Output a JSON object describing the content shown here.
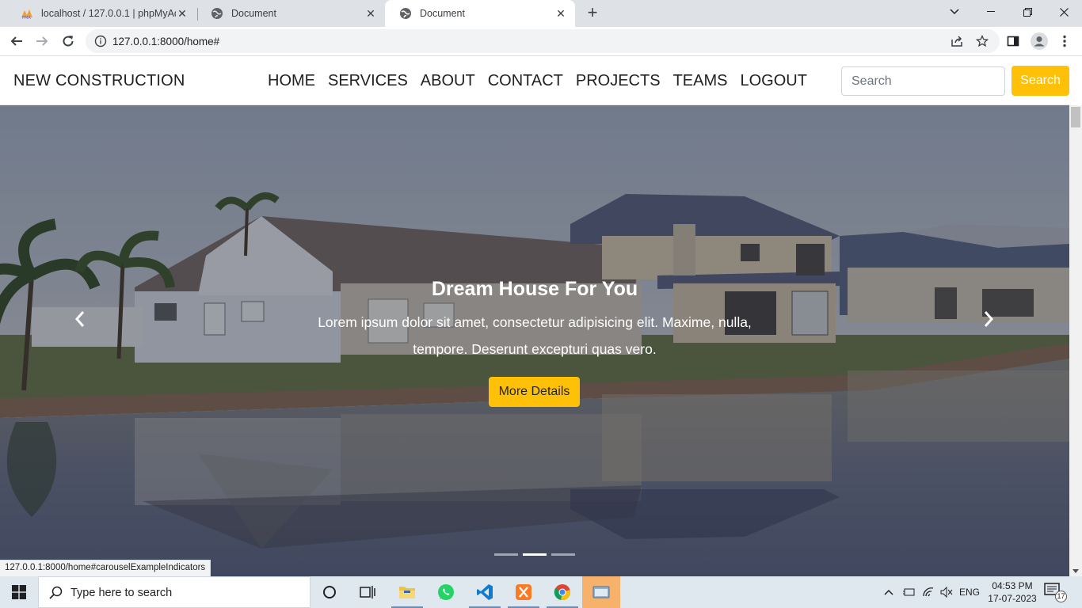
{
  "browser": {
    "tabs": [
      {
        "title": "localhost / 127.0.0.1 | phpMyAdm",
        "icon": "phpmyadmin-icon",
        "active": false
      },
      {
        "title": "Document",
        "icon": "globe-icon",
        "active": false
      },
      {
        "title": "Document",
        "icon": "globe-icon",
        "active": true
      }
    ],
    "url": "127.0.0.1:8000/home#",
    "status_url": "127.0.0.1:8000/home#carouselExampleIndicators"
  },
  "site": {
    "brand": "NEW CONSTRUCTION",
    "menu": [
      "HOME",
      "SERVICES",
      "ABOUT",
      "CONTACT",
      "PROJECTS",
      "TEAMS",
      "LOGOUT"
    ],
    "search": {
      "placeholder": "Search",
      "button": "Search"
    },
    "accent_color": "#ffc107"
  },
  "carousel": {
    "title": "Dream House For You",
    "text_line1": "Lorem ipsum dolor sit amet, consectetur adipisicing elit. Maxime, nulla,",
    "text_line2": "tempore. Deserunt excepturi quas vero.",
    "button": "More Details",
    "slide_count": 3,
    "active_slide": 2
  },
  "taskbar": {
    "search_placeholder": "Type here to search",
    "apps": [
      "cortana-icon",
      "task-view-icon",
      "file-explorer-icon",
      "whatsapp-icon",
      "vscode-icon",
      "xampp-icon",
      "chrome-icon",
      "app-window-icon"
    ],
    "language": "ENG",
    "time": "04:53 PM",
    "date": "17-07-2023",
    "notification_count": "17"
  }
}
